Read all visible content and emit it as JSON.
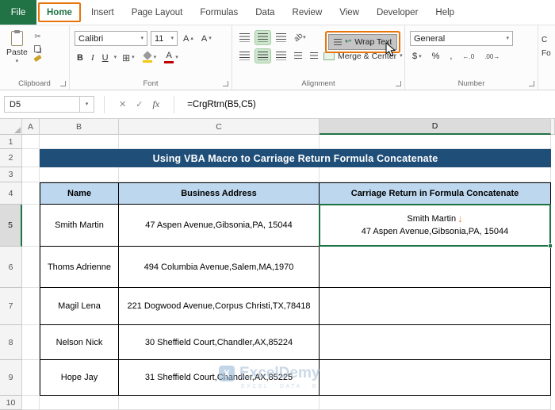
{
  "ribbon": {
    "tabs": [
      "File",
      "Home",
      "Insert",
      "Page Layout",
      "Formulas",
      "Data",
      "Review",
      "View",
      "Developer",
      "Help"
    ],
    "clipboard": {
      "label": "Clipboard",
      "paste": "Paste"
    },
    "font": {
      "label": "Font",
      "name": "Calibri",
      "size": "11",
      "bold": "B",
      "italic": "I",
      "underline": "U",
      "grow": "A",
      "shrink": "A",
      "font_color": "A"
    },
    "alignment": {
      "label": "Alignment",
      "wrap_text": "Wrap Text",
      "merge_center": "Merge & Center",
      "orientation_letters": "ab"
    },
    "number": {
      "label": "Number",
      "format": "General",
      "dollar": "$",
      "percent": "%",
      "comma": ",",
      "increase_decimal": "←.0",
      "decrease_decimal": ".00→"
    },
    "clipped_right": {
      "line1": "C",
      "line2": "Fo"
    }
  },
  "formula_bar": {
    "name_box": "D5",
    "formula": "=CrgRtrn(B5,C5)"
  },
  "icons": {
    "dropdown": "▾",
    "cancel": "✕",
    "confirm": "✓",
    "fx": "fx",
    "down_arrow": "↓",
    "scissors": "✂",
    "wrap_return": "↩",
    "up_small": "▴",
    "borders": "⊞"
  },
  "sheet": {
    "col_headers": [
      "A",
      "B",
      "C",
      "D"
    ],
    "row_headers": [
      "1",
      "2",
      "3",
      "4",
      "5",
      "6",
      "7",
      "8",
      "9",
      "10"
    ],
    "selected_cell": "D5",
    "title": "Using VBA Macro to Carriage Return Formula Concatenate",
    "table": {
      "headers": [
        "Name",
        "Business Address",
        "Carriage Return in Formula Concatenate"
      ],
      "rows": [
        {
          "name": "Smith Martin",
          "address": "47 Aspen Avenue,Gibsonia,PA, 15044",
          "result_line1": "Smith Martin",
          "result_line2": "47 Aspen Avenue,Gibsonia,PA, 15044"
        },
        {
          "name": "Thoms Adrienne",
          "address": "494 Columbia Avenue,Salem,MA,1970",
          "result_line1": "",
          "result_line2": ""
        },
        {
          "name": "Magil Lena",
          "address": "221 Dogwood Avenue,Corpus Christi,TX,78418",
          "result_line1": "",
          "result_line2": ""
        },
        {
          "name": "Nelson Nick",
          "address": "30 Sheffield Court,Chandler,AX,85224",
          "result_line1": "",
          "result_line2": ""
        },
        {
          "name": "Hope Jay",
          "address": "31 Sheffield Court,Chandler,AX,85225",
          "result_line1": "",
          "result_line2": ""
        }
      ]
    },
    "watermark": {
      "logo_letter": "X",
      "brand": "ExcelDemy",
      "tagline": "EXCEL · DATA · B"
    }
  },
  "colors": {
    "file_tab_green": "#217346",
    "annotation_orange": "#E8740C",
    "banner_blue": "#1F4E78",
    "table_header_fill": "#BDD7EE",
    "selection_green": "#1E7145",
    "arrow_orange": "#ED7D31"
  }
}
